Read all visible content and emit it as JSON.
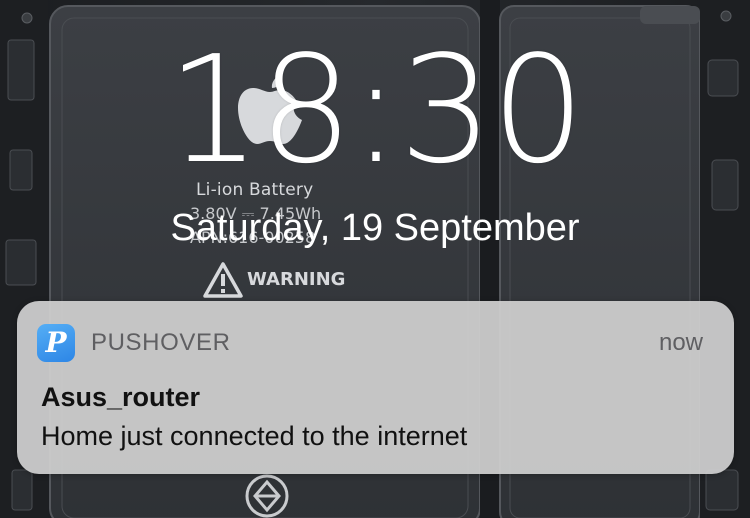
{
  "lock_screen": {
    "time": "18:30",
    "date": "Saturday, 19 September"
  },
  "wallpaper": {
    "battery_label": "Li-ion Battery",
    "battery_spec_line1": "3.80V ⎓ 7.45Wh",
    "battery_spec_line2": "APN:616-00258",
    "warning_text": "WARNING"
  },
  "notification": {
    "app_name": "PUSHOVER",
    "app_icon_glyph": "P",
    "app_icon_color": "#3a92ee",
    "time": "now",
    "title": "Asus_router",
    "body": "Home just connected to the internet"
  }
}
